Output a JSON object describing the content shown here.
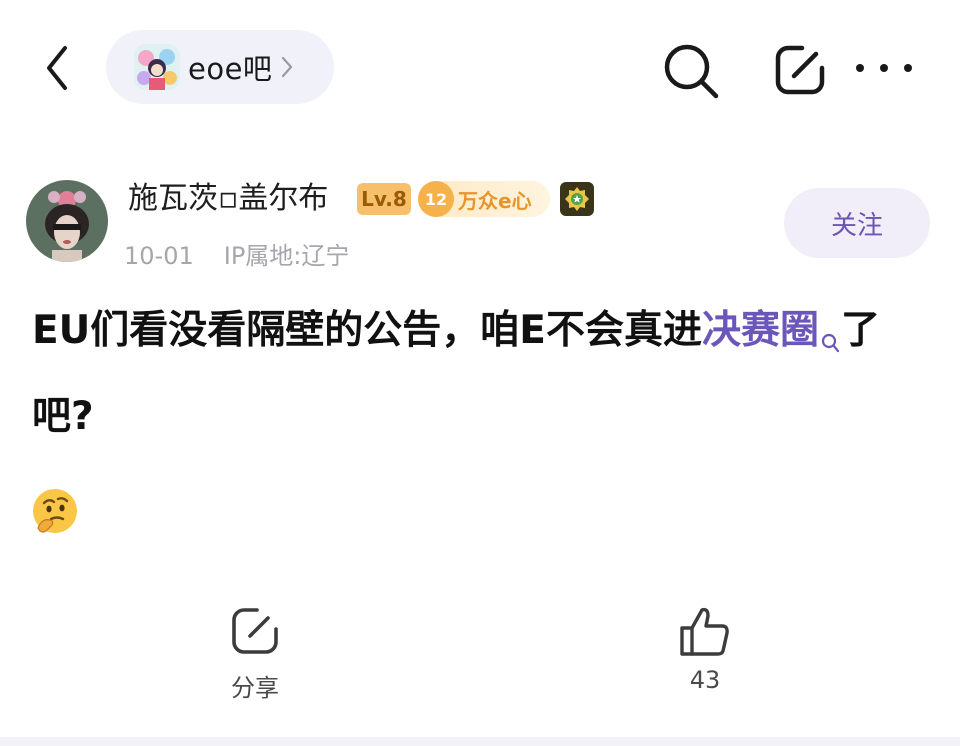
{
  "header": {
    "forum_name": "eoe吧",
    "icons": {
      "back": "chevron-left-icon",
      "forum_chevron": "chevron-right-icon",
      "search": "search-icon",
      "edit": "edit-icon",
      "more": "more-icon"
    }
  },
  "author": {
    "name": "施瓦茨▫盖尔布",
    "level_badge": "Lv.8",
    "fan_level": "12",
    "fan_title": "万众e心",
    "date": "10-01",
    "ip_location": "IP属地:辽宁",
    "follow_label": "关注"
  },
  "post": {
    "title_part1": "EU们看没看隔壁的公告，咱E不会真进",
    "title_link": "决赛圈",
    "title_part2": "了吧?",
    "emoji": "thinking-face"
  },
  "actions": {
    "share_label": "分享",
    "like_count": "43"
  },
  "colors": {
    "accent": "#6b57b9",
    "follow_bg": "#f1eef9",
    "pill_bg": "#f1f1f9",
    "level_badge": "#f6c06a"
  }
}
